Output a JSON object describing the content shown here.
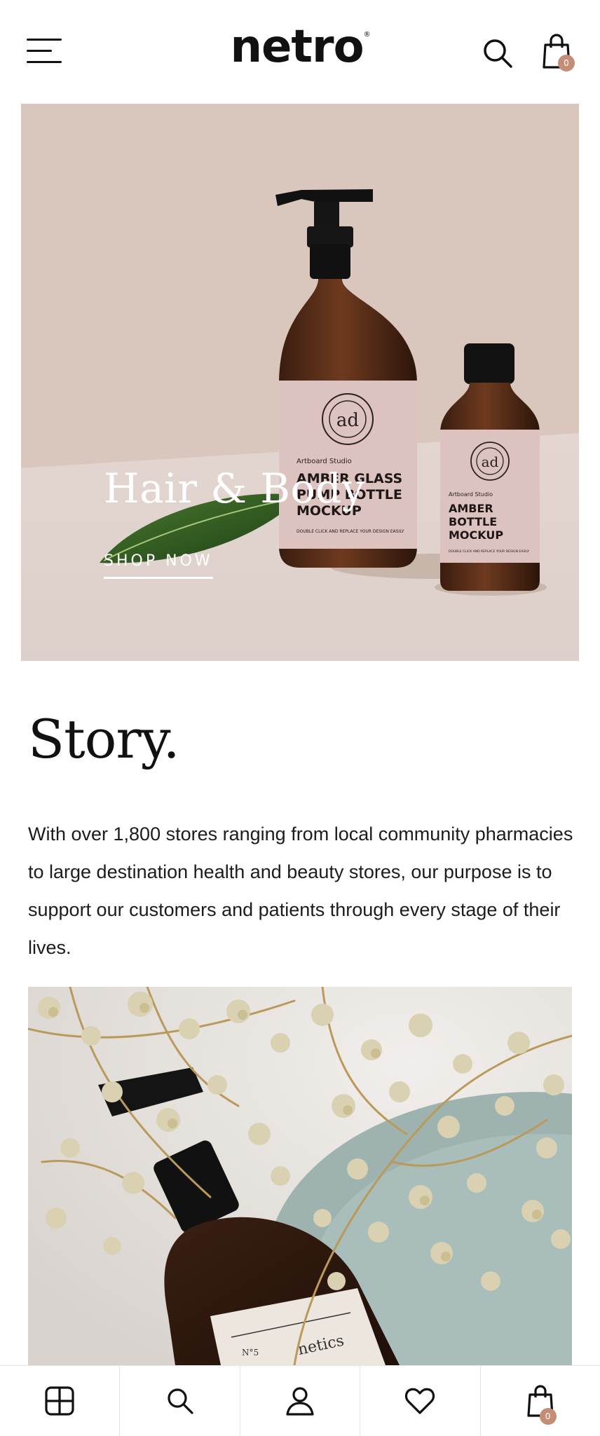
{
  "header": {
    "logo_text": "netro",
    "logo_mark": "®",
    "menu_icon": "hamburger-menu-icon",
    "search_icon": "search-icon",
    "cart_icon": "shopping-bag-icon",
    "cart_count": "0"
  },
  "hero": {
    "title": "Hair & Body",
    "cta_label": "SHOP NOW",
    "image_description_icon": "product-bottles-image",
    "background_color": "#dccbc2",
    "big_bottle": {
      "brand": "Artboard Studio",
      "line1": "AMBER GLASS",
      "line2": "PUMP BOTTLE",
      "line3": "MOCKUP",
      "small": "DOUBLE CLICK AND REPLACE YOUR DESIGN EASILY"
    },
    "small_bottle": {
      "brand": "Artboard Studio",
      "line1": "AMBER",
      "line2": "BOTTLE",
      "line3": "MOCKUP",
      "small": "DOUBLE CLICK AND REPLACE YOUR DESIGN EASILY"
    }
  },
  "story": {
    "title": "Story.",
    "text": "With over 1,800 stores ranging from local community pharmacies to large destination health and beauty stores, our purpose is to support our customers and patients through every stage of their lives.",
    "image_label": "N°5",
    "image_text": "netics"
  },
  "bottom_nav": {
    "items": [
      {
        "icon": "grid-icon"
      },
      {
        "icon": "search-icon"
      },
      {
        "icon": "account-icon"
      },
      {
        "icon": "heart-icon"
      },
      {
        "icon": "shopping-bag-icon",
        "badge": "0"
      }
    ]
  },
  "colors": {
    "accent": "#c38e74",
    "text": "#111111"
  }
}
